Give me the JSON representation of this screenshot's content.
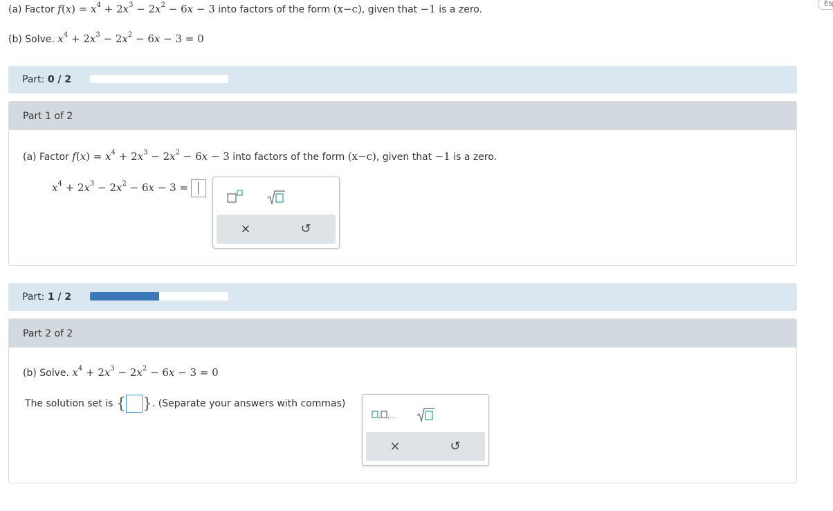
{
  "language_link": "Español",
  "problem": {
    "a_prefix": "(a) Factor ",
    "a_suffix": " into factors of the form ",
    "a_form": "(x−c)",
    "a_given": ", given that ",
    "a_zero": "−1",
    "a_end": " is a zero.",
    "b_prefix": "(b) Solve. ",
    "b_equation_end": " = 0"
  },
  "progress_a": {
    "label": "Part:",
    "value": "0 / 2",
    "fraction": 0.0
  },
  "progress_b": {
    "label": "Part:",
    "value": "1 / 2",
    "fraction": 0.5
  },
  "part1": {
    "header": "Part 1 of 2",
    "equals": " ="
  },
  "part2": {
    "header": "Part 2 of 2",
    "solution_prefix": "The solution set is",
    "solution_suffix": ". (Separate your answers with commas)"
  },
  "palette1": {
    "tools": [
      "superscript-icon",
      "sqrt-icon"
    ],
    "actions": [
      "clear-icon",
      "undo-icon"
    ]
  },
  "palette2": {
    "tools": [
      "list-icon",
      "sqrt-icon"
    ],
    "actions": [
      "clear-icon",
      "undo-icon"
    ]
  },
  "colors": {
    "accent": "#3a78b8",
    "bar_bg": "#dae6f0",
    "header_bg": "#d3dadf",
    "teal": "#2a9d9d"
  }
}
